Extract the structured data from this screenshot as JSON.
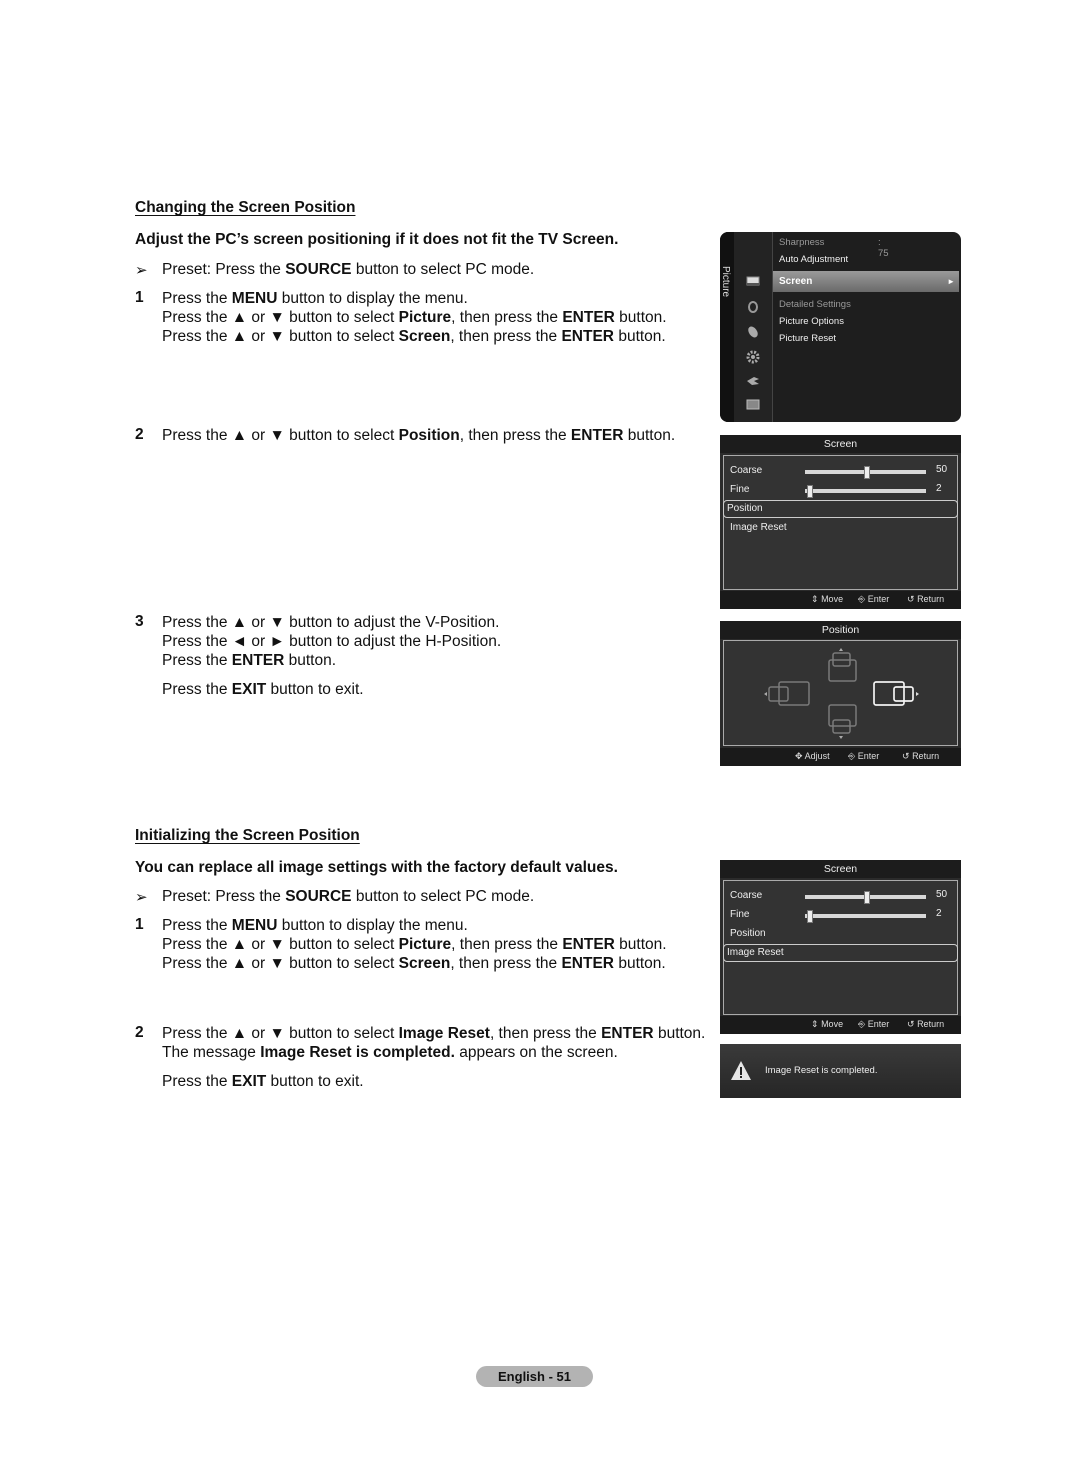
{
  "section1": {
    "heading": "Changing the Screen Position",
    "subheading": "Adjust the PC’s screen positioning if it does not fit the TV Screen.",
    "preset": {
      "arrow": "➢",
      "pre": "Preset: Press the ",
      "bold": "SOURCE",
      "post": " button to select PC mode."
    },
    "steps": [
      {
        "num": "1",
        "lines": [
          {
            "parts": [
              {
                "t": "Press the "
              },
              {
                "b": "MENU"
              },
              {
                "t": " button to display the menu."
              }
            ]
          },
          {
            "parts": [
              {
                "t": "Press the ▲ or ▼ button to select "
              },
              {
                "b": "Picture"
              },
              {
                "t": ", then press the "
              },
              {
                "b": "ENTER"
              },
              {
                "t": " button."
              }
            ]
          },
          {
            "parts": [
              {
                "t": "Press the ▲ or ▼ button to select "
              },
              {
                "b": "Screen"
              },
              {
                "t": ", then press the "
              },
              {
                "b": "ENTER"
              },
              {
                "t": " button."
              }
            ]
          }
        ]
      },
      {
        "num": "2",
        "lines": [
          {
            "parts": [
              {
                "t": "Press the ▲ or ▼ button to select "
              },
              {
                "b": "Position"
              },
              {
                "t": ", then press the "
              },
              {
                "b": "ENTER"
              },
              {
                "t": " button."
              }
            ]
          }
        ]
      },
      {
        "num": "3",
        "lines": [
          {
            "parts": [
              {
                "t": "Press the ▲ or ▼ button to adjust the V-Position."
              }
            ]
          },
          {
            "parts": [
              {
                "t": "Press the ◄ or ► button to adjust the H-Position."
              }
            ]
          },
          {
            "parts": [
              {
                "t": "Press the "
              },
              {
                "b": "ENTER"
              },
              {
                "t": " button."
              }
            ]
          }
        ]
      }
    ],
    "exit_line": {
      "parts": [
        {
          "t": "Press the "
        },
        {
          "b": "EXIT"
        },
        {
          "t": " button to exit."
        }
      ]
    }
  },
  "section2": {
    "heading": "Initializing the Screen Position",
    "subheading": "You can replace all image settings with the factory default values.",
    "preset": {
      "arrow": "➢",
      "pre": "Preset: Press the ",
      "bold": "SOURCE",
      "post": " button to select PC mode."
    },
    "steps": [
      {
        "num": "1",
        "lines": [
          {
            "parts": [
              {
                "t": "Press the "
              },
              {
                "b": "MENU"
              },
              {
                "t": " button to display the menu."
              }
            ]
          },
          {
            "parts": [
              {
                "t": "Press the ▲ or ▼ button to select "
              },
              {
                "b": "Picture"
              },
              {
                "t": ", then press the "
              },
              {
                "b": "ENTER"
              },
              {
                "t": " button."
              }
            ]
          },
          {
            "parts": [
              {
                "t": "Press the ▲ or ▼ button to select "
              },
              {
                "b": "Screen"
              },
              {
                "t": ", then press the "
              },
              {
                "b": "ENTER"
              },
              {
                "t": " button."
              }
            ]
          }
        ]
      },
      {
        "num": "2",
        "lines": [
          {
            "parts": [
              {
                "t": "Press the ▲ or ▼ button to select "
              },
              {
                "b": "Image Reset"
              },
              {
                "t": ", then press the "
              },
              {
                "b": "ENTER"
              },
              {
                "t": " button."
              }
            ]
          },
          {
            "parts": [
              {
                "t": "The message "
              },
              {
                "b": "Image Reset is completed."
              },
              {
                "t": " appears on the screen."
              }
            ]
          }
        ]
      }
    ],
    "exit_line": {
      "parts": [
        {
          "t": "Press the "
        },
        {
          "b": "EXIT"
        },
        {
          "t": " button to exit."
        }
      ]
    }
  },
  "picture_menu": {
    "side_label": "Picture",
    "icons": [
      "picture-icon",
      "sound-icon",
      "channel-icon",
      "setup-icon",
      "input-icon",
      "application-icon"
    ],
    "items": [
      {
        "label": "Sharpness",
        "value": ": 75",
        "state": "dim"
      },
      {
        "label": "Auto Adjustment",
        "state": "normal"
      },
      {
        "label": "Screen",
        "state": "selected",
        "arrow": "►"
      },
      {
        "label": "Detailed Settings",
        "state": "dim"
      },
      {
        "label": "Picture Options",
        "state": "normal"
      },
      {
        "label": "Picture Reset",
        "state": "normal"
      }
    ]
  },
  "screen_menu_1": {
    "title": "Screen",
    "rows": [
      {
        "label": "Coarse",
        "value": "50",
        "fraction": 0.5
      },
      {
        "label": "Fine",
        "value": "2",
        "fraction": 0.02
      },
      {
        "label": "Position",
        "selected": true
      },
      {
        "label": "Image Reset"
      }
    ],
    "footer": {
      "move": "Move",
      "enter": "Enter",
      "return": "Return"
    }
  },
  "position_menu": {
    "title": "Position",
    "footer": {
      "adjust": "Adjust",
      "enter": "Enter",
      "return": "Return"
    }
  },
  "screen_menu_2": {
    "title": "Screen",
    "rows": [
      {
        "label": "Coarse",
        "value": "50",
        "fraction": 0.5
      },
      {
        "label": "Fine",
        "value": "2",
        "fraction": 0.02
      },
      {
        "label": "Position"
      },
      {
        "label": "Image Reset",
        "selected": true
      }
    ],
    "footer": {
      "move": "Move",
      "enter": "Enter",
      "return": "Return"
    }
  },
  "message": {
    "text": "Image Reset is completed.",
    "icon": "warning-icon"
  },
  "page_footer": {
    "label": "English - 51"
  }
}
